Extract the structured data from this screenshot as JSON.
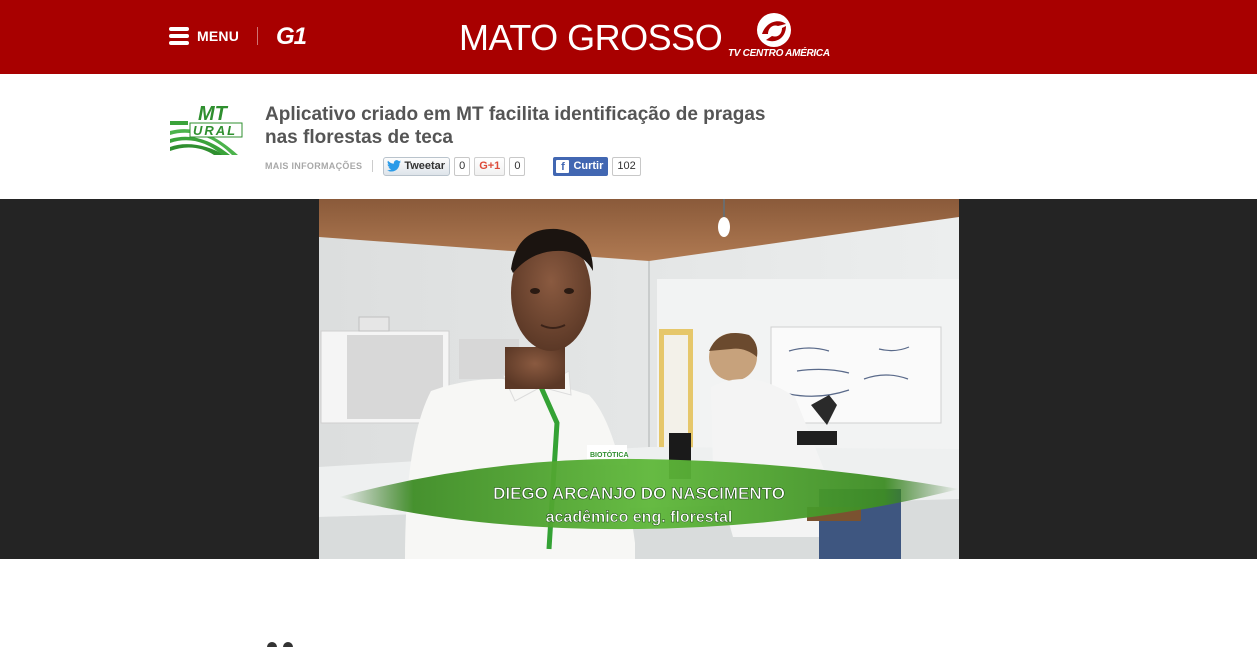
{
  "header": {
    "menu_label": "MENU",
    "g1_logo": "G1",
    "region_title": "MATO GROSSO",
    "affiliate": "TV CENTRO AMÉRICA",
    "background_color": "#a80000"
  },
  "article": {
    "program_logo_text_top": "MT",
    "program_logo_text_bottom": "URAL",
    "headline": "Aplicativo criado em MT facilita identificação de pragas nas florestas de teca",
    "more_info": "MAIS INFORMAÇÕES",
    "share": {
      "tweet_label": "Tweetar",
      "tweet_count": "0",
      "gplus_label": "G+1",
      "gplus_count": "0",
      "facebook_label": "Curtir",
      "facebook_count": "102"
    }
  },
  "video": {
    "caption_name": "DIEGO ARCANJO DO NASCIMENTO",
    "caption_role": "acadêmico eng. florestal",
    "shirt_logo": "BIOTÓTICA"
  },
  "icons": [
    "menu-icon",
    "twitter-bird-icon",
    "facebook-f-icon",
    "tv-centro-america-logo-icon"
  ]
}
